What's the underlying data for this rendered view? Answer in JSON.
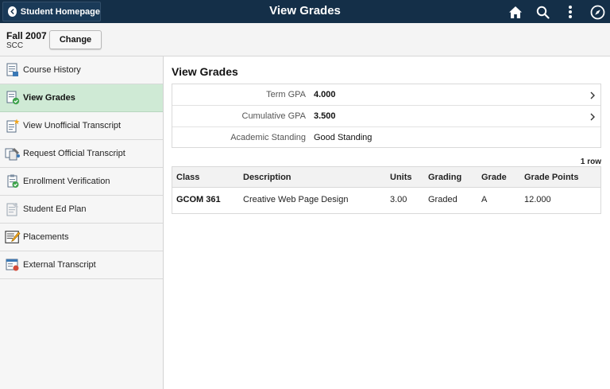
{
  "header": {
    "home_label": "Student Homepage",
    "title": "View Grades",
    "icons": [
      "back-icon",
      "home-icon",
      "search-icon",
      "more-options-icon",
      "navbar-compass-icon"
    ]
  },
  "term": {
    "name": "Fall 2007",
    "institution": "SCC",
    "change_label": "Change"
  },
  "sidebar": {
    "items": [
      {
        "label": "Course History",
        "icon": "course-history-icon"
      },
      {
        "label": "View Grades",
        "icon": "view-grades-icon",
        "active": true
      },
      {
        "label": "View Unofficial Transcript",
        "icon": "unofficial-transcript-icon"
      },
      {
        "label": "Request Official Transcript",
        "icon": "request-transcript-icon"
      },
      {
        "label": "Enrollment Verification",
        "icon": "enrollment-verification-icon"
      },
      {
        "label": "Student Ed Plan",
        "icon": "ed-plan-icon"
      },
      {
        "label": "Placements",
        "icon": "placements-icon"
      },
      {
        "label": "External Transcript",
        "icon": "external-transcript-icon"
      }
    ]
  },
  "main": {
    "title": "View Grades",
    "gpa": {
      "term_label": "Term GPA",
      "term_value": "4.000",
      "cumulative_label": "Cumulative GPA",
      "cumulative_value": "3.500",
      "standing_label": "Academic Standing",
      "standing_value": "Good Standing"
    },
    "row_count": "1 row",
    "table": {
      "columns": [
        "Class",
        "Description",
        "Units",
        "Grading",
        "Grade",
        "Grade Points"
      ],
      "rows": [
        {
          "class": "GCOM 361",
          "description": "Creative Web Page Design",
          "units": "3.00",
          "grading": "Graded",
          "grade": "A",
          "grade_points": "12.000"
        }
      ]
    }
  },
  "colors": {
    "header_bg": "#142f48",
    "active_nav_bg": "#cfead5",
    "sidebar_bg": "#f6f6f6"
  }
}
